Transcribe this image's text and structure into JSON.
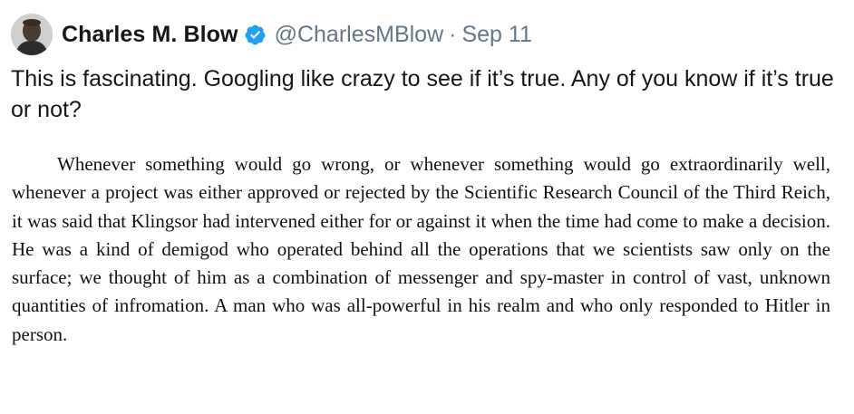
{
  "tweet": {
    "author": {
      "name": "Charles M. Blow",
      "handle": "@CharlesMBlow",
      "verified_icon": "verified-badge-icon",
      "avatar_icon": "avatar-photo"
    },
    "separator": "·",
    "date": "Sep 11",
    "text": "This is fascinating. Googling like crazy to see if it’s true. Any of you know if it’s true or not?",
    "image": {
      "passage": "Whenever something would go wrong, or whenever something would go extraordinarily well, whenever a project was either approved or rejected by the Scientific Research Council of the Third Reich, it was said that Klingsor had intervened either for or against it when the time had come to make a decision. He was a kind of demigod who operated behind all the operations that we scientists saw only on the surface; we thought of him as a combination of messenger and spy-master in control of vast, unknown quantities of infromation. A man who was all-powerful in his realm and who only responded to Hitler in person."
    }
  },
  "colors": {
    "verified": "#1da1f2",
    "secondary_text": "#657786",
    "primary_text": "#14171a"
  }
}
